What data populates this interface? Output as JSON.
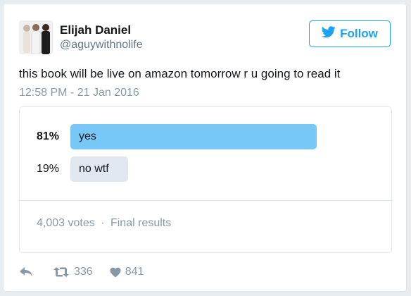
{
  "tweet": {
    "author_name": "Elijah Daniel",
    "author_handle": "@aguywithnolife",
    "follow_label": "Follow",
    "text": "this book will be live on amazon tomorrow r u going to read it",
    "timestamp": "12:58 PM - 21 Jan 2016"
  },
  "poll": {
    "options": [
      {
        "percent_label": "81%",
        "label": "yes",
        "fraction": 0.81,
        "winner": true
      },
      {
        "percent_label": "19%",
        "label": "no wtf",
        "fraction": 0.19,
        "winner": false
      }
    ],
    "votes": "4,003 votes",
    "separator": "·",
    "status": "Final results"
  },
  "actions": {
    "retweets": "336",
    "likes": "841"
  },
  "colors": {
    "brand": "#1da1f2",
    "winner_bar": "#77c7f7",
    "other_bar": "#e1e8ed",
    "muted": "#8899a6"
  },
  "icons": {
    "follow": "bird-icon",
    "reply": "reply-icon",
    "retweet": "retweet-icon",
    "like": "heart-icon"
  }
}
